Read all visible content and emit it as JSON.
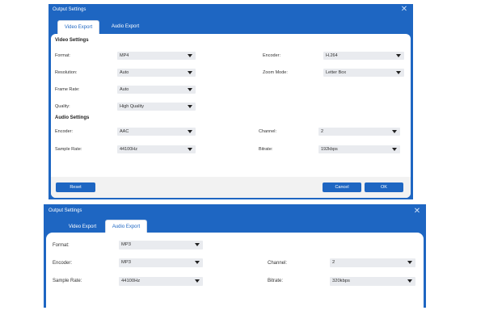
{
  "dialog": {
    "title": "Output Settings",
    "close_icon": "close-icon",
    "tabs": [
      "Video Export",
      "Audio Export"
    ]
  },
  "video_export": {
    "section_video": "Video Settings",
    "format_label": "Format:",
    "format_value": "MP4",
    "resolution_label": "Resolution:",
    "resolution_value": "Auto",
    "frame_rate_label": "Frame Rate:",
    "frame_rate_value": "Auto",
    "quality_label": "Quality:",
    "quality_value": "High Quality",
    "encoder_label": "Encoder:",
    "encoder_value": "H.264",
    "zoom_mode_label": "Zoom Mode:",
    "zoom_mode_value": "Letter Box",
    "section_audio": "Audio Settings",
    "audio_encoder_label": "Encoder:",
    "audio_encoder_value": "AAC",
    "sample_rate_label": "Sample Rate:",
    "sample_rate_value": "44100Hz",
    "channel_label": "Channel:",
    "channel_value": "2",
    "bitrate_label": "Bitrate:",
    "bitrate_value": "192kbps"
  },
  "audio_export": {
    "format_label": "Format:",
    "format_value": "MP3",
    "encoder_label": "Encoder:",
    "encoder_value": "MP3",
    "sample_rate_label": "Sample Rate:",
    "sample_rate_value": "44100Hz",
    "channel_label": "Channel:",
    "channel_value": "2",
    "bitrate_label": "Bitrate:",
    "bitrate_value": "320kbps"
  },
  "footer": {
    "reset_label": "Reset",
    "cancel_label": "Cancel",
    "ok_label": "OK"
  },
  "colors": {
    "accent": "#1e66c2",
    "select_bg": "#e9ebef",
    "footer_bg": "#f2f2f2"
  }
}
